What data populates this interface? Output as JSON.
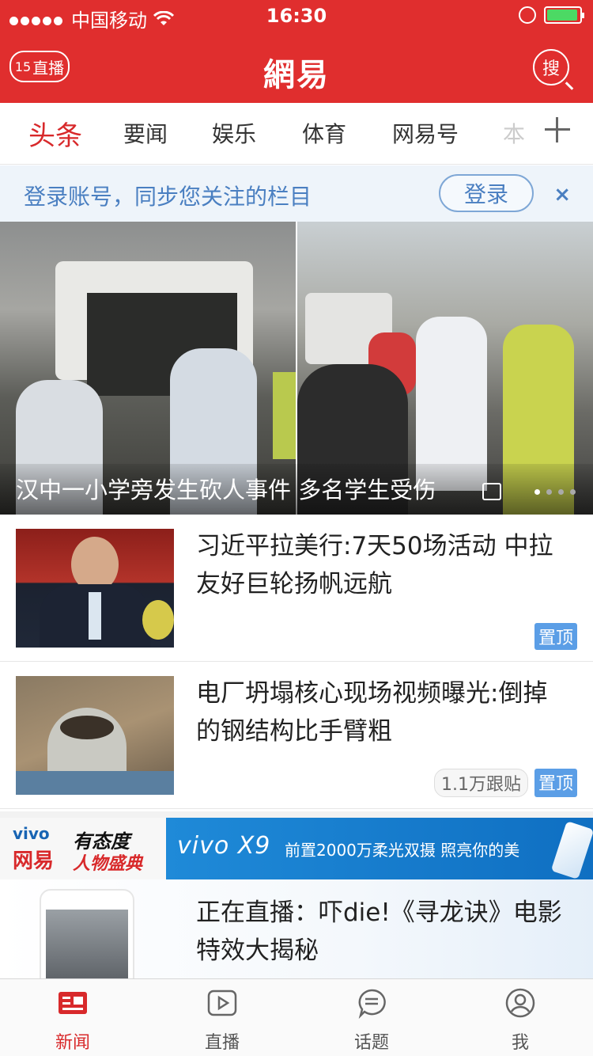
{
  "status_bar": {
    "carrier": "中国移动",
    "time": "16:30"
  },
  "header": {
    "live_count": "15",
    "live_label": "直播",
    "logo": "網易",
    "search_label": "搜"
  },
  "tabs": [
    {
      "label": "头条",
      "active": true
    },
    {
      "label": "要闻"
    },
    {
      "label": "娱乐"
    },
    {
      "label": "体育"
    },
    {
      "label": "网易号"
    },
    {
      "label": "本"
    }
  ],
  "login_banner": {
    "text": "登录账号，同步您关注的栏目",
    "button": "登录",
    "close": "×"
  },
  "hero": {
    "caption": "汉中一小学旁发生砍人事件 多名学生受伤"
  },
  "news": [
    {
      "title": "习近平拉美行:7天50场活动 中拉友好巨轮扬帆远航",
      "pin": "置顶"
    },
    {
      "title": "电厂坍塌核心现场视频曝光:倒掉的钢结构比手臂粗",
      "comments": "1.1万跟贴",
      "pin": "置顶"
    }
  ],
  "ad": {
    "brand": "vivo",
    "brand2": "网易",
    "slogan": "有态度",
    "slogan2": "人物盛典",
    "product": "vivo X9",
    "product_text": "前置2000万柔光双摄 照亮你的美",
    "title": "正在直播：吓die!《寻龙诀》电影特效大揭秘",
    "subtitle": "……"
  },
  "tabbar": [
    {
      "label": "新闻",
      "icon": "news-icon",
      "active": true
    },
    {
      "label": "直播",
      "icon": "play-icon"
    },
    {
      "label": "话题",
      "icon": "chat-icon"
    },
    {
      "label": "我",
      "icon": "user-icon"
    }
  ],
  "colors": {
    "brand_red": "#e02e2e",
    "link_blue": "#4a7fc1",
    "pin_blue": "#5b9ee6"
  }
}
